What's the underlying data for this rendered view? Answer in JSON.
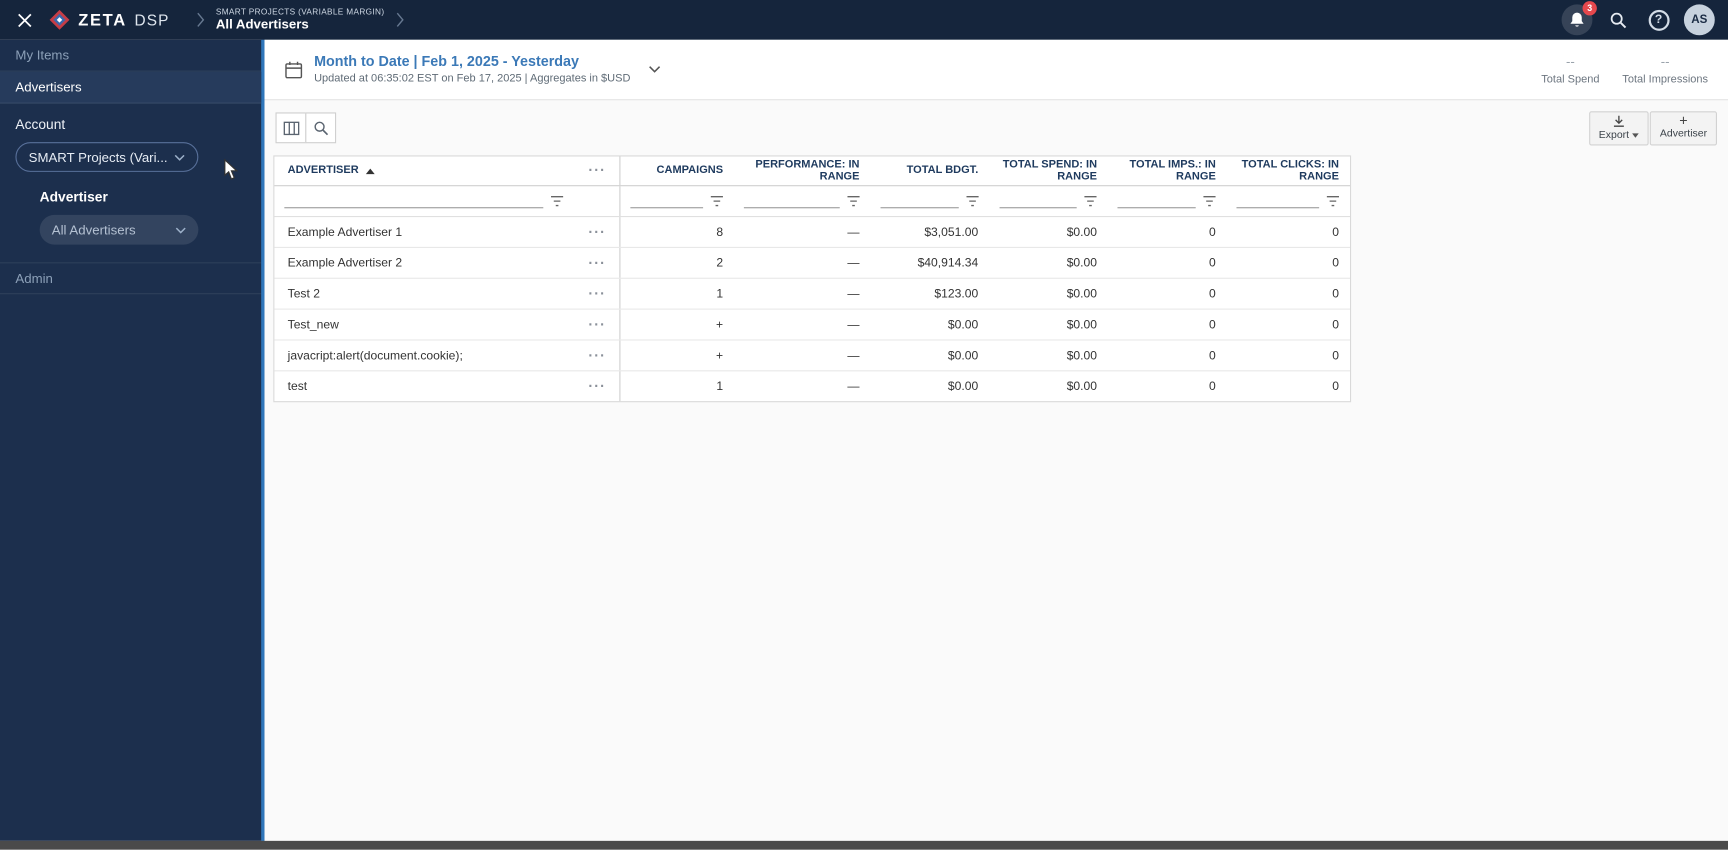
{
  "topbar": {
    "logo_zeta": "ZETA",
    "logo_dsp": "DSP",
    "breadcrumb_account": "SMART PROJECTS (VARIABLE MARGIN)",
    "breadcrumb_page": "All Advertisers",
    "notification_badge": "3",
    "help_glyph": "?",
    "avatar_initials": "AS"
  },
  "sidebar": {
    "my_items": "My Items",
    "advertisers": "Advertisers",
    "account_label": "Account",
    "account_value": "SMART Projects (Vari...",
    "advertiser_label": "Advertiser",
    "advertiser_value": "All Advertisers",
    "admin": "Admin"
  },
  "date_header": {
    "range": "Month to Date | Feb 1, 2025 - Yesterday",
    "updated": "Updated at 06:35:02 EST on Feb 17, 2025 | Aggregates in $USD",
    "metrics": [
      {
        "value": "--",
        "label": "Total Spend"
      },
      {
        "value": "--",
        "label": "Total Impressions"
      }
    ]
  },
  "toolbar": {
    "export_label": "Export",
    "add_advertiser_label": "Advertiser",
    "plus_glyph": "+"
  },
  "table": {
    "columns": [
      "ADVERTISER",
      "CAMPAIGNS",
      "PERFORMANCE: IN RANGE",
      "TOTAL BDGT.",
      "TOTAL SPEND: IN RANGE",
      "TOTAL IMPS.: IN RANGE",
      "TOTAL CLICKS: IN RANGE"
    ],
    "more_glyph": "···",
    "rows": [
      {
        "name": "Example Advertiser 1",
        "campaigns": "8",
        "performance": "—",
        "budget": "$3,051.00",
        "spend": "$0.00",
        "imps": "0",
        "clicks": "0"
      },
      {
        "name": "Example Advertiser 2",
        "campaigns": "2",
        "performance": "—",
        "budget": "$40,914.34",
        "spend": "$0.00",
        "imps": "0",
        "clicks": "0"
      },
      {
        "name": "Test 2",
        "campaigns": "1",
        "performance": "—",
        "budget": "$123.00",
        "spend": "$0.00",
        "imps": "0",
        "clicks": "0"
      },
      {
        "name": "Test_new",
        "campaigns": "+",
        "performance": "—",
        "budget": "$0.00",
        "spend": "$0.00",
        "imps": "0",
        "clicks": "0"
      },
      {
        "name": "javacript:alert(document.cookie);",
        "campaigns": "+",
        "performance": "—",
        "budget": "$0.00",
        "spend": "$0.00",
        "imps": "0",
        "clicks": "0"
      },
      {
        "name": "test",
        "campaigns": "1",
        "performance": "—",
        "budget": "$0.00",
        "spend": "$0.00",
        "imps": "0",
        "clicks": "0"
      }
    ]
  },
  "colors": {
    "navy": "#15253c",
    "sidebar_navy": "#1c2f4d",
    "accent_blue": "#3b79b7",
    "sidebar_accent": "#2f76ba",
    "badge_red": "#e5484d"
  }
}
